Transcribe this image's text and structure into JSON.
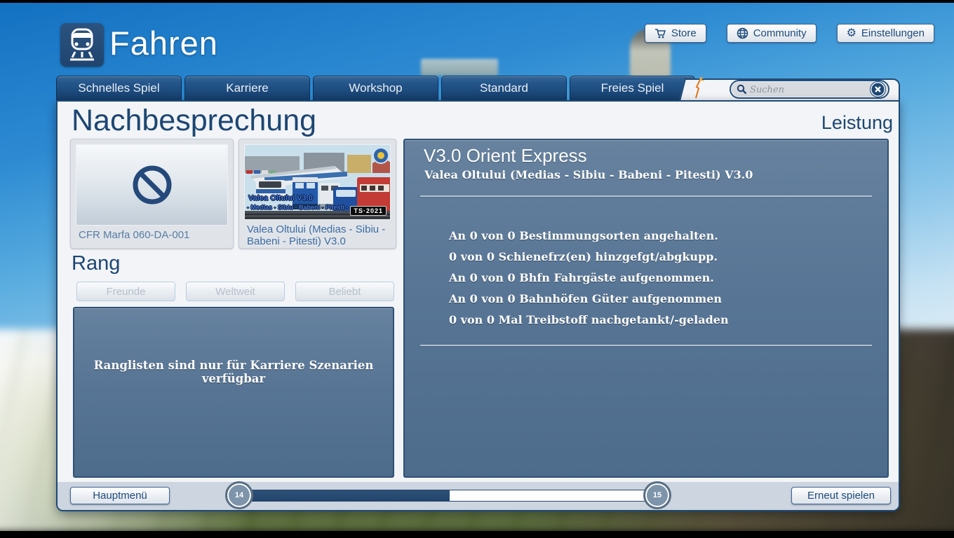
{
  "app": {
    "title": "Fahren"
  },
  "topbar": {
    "store": "Store",
    "community": "Community",
    "settings": "Einstellungen"
  },
  "tabs": [
    "Schnelles Spiel",
    "Karriere",
    "Workshop",
    "Standard",
    "Freies Spiel"
  ],
  "search": {
    "placeholder": "Suchen"
  },
  "page": {
    "title": "Nachbesprechung",
    "performance_title": "Leistung"
  },
  "results": {
    "loco_card": {
      "label": "CFR Marfa 060-DA-001"
    },
    "route_card": {
      "label": "Valea Oltului (Medias - Sibiu - Babeni - Pitesti) V3.0",
      "overlay_title": "Valea Oltului V3.0",
      "overlay_subtitle": "- Medias - Sibiu -  Babeni -  Pitesti -",
      "badge": "TS·2021"
    }
  },
  "rang": {
    "title": "Rang",
    "filter_buttons": [
      "Freunde",
      "Weltweit",
      "Beliebt"
    ],
    "empty_message": "Ranglisten sind nur für Karriere Szenarien verfügbar"
  },
  "performance": {
    "scenario_title": "V3.0 Orient Express",
    "route_subtitle": "Valea Oltului (Medias - Sibiu - Babeni - Pitesti) V3.0",
    "stats": [
      "An 0 von 0 Bestimmungsorten angehalten.",
      "0 von 0 Schienefrz(en) hinzgefgt/abgkupp.",
      "An 0 von 0 Bhfn Fahrgäste aufgenommen.",
      "An 0 von 0 Bahnhöfen Güter aufgenommen",
      "0 von 0 Mal Treibstoff nachgetankt/-geladen"
    ]
  },
  "footer": {
    "main_menu": "Hauptmenü",
    "replay": "Erneut spielen",
    "progress": {
      "from_level": "14",
      "to_level": "15",
      "fill_style": "width:50.3%"
    }
  },
  "colors": {
    "accent_navy": "#1e4976",
    "panel_slate": "#5b7a99",
    "tab_blue": "#1c4a7c"
  }
}
